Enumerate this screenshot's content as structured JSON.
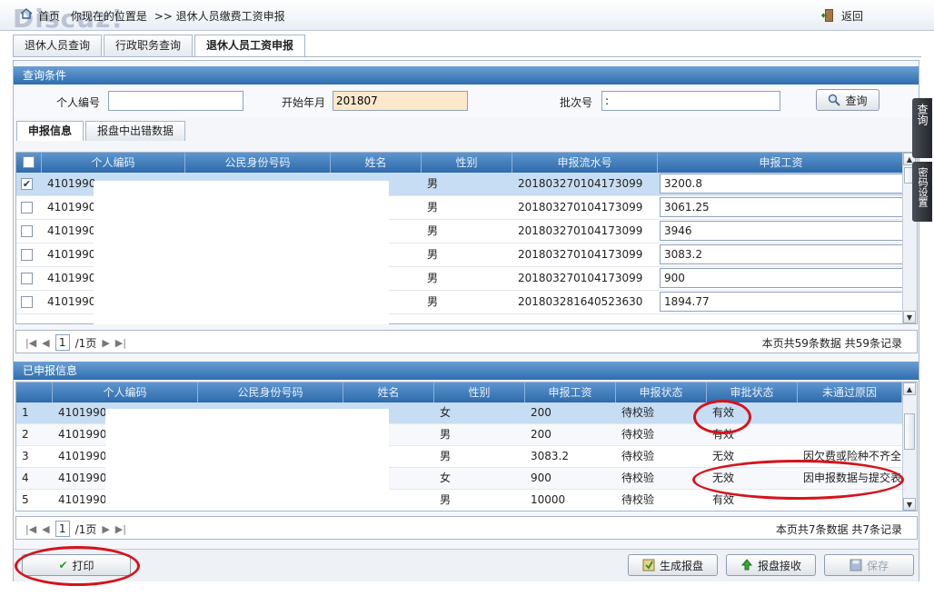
{
  "topbar": {
    "home_label": "首页",
    "location_prefix": "你现在的位置是",
    "location_path": ">> 退休人员缴费工资申报",
    "back_label": "返回",
    "watermark": "Discuz!"
  },
  "main_tabs": [
    {
      "label": "退休人员查询"
    },
    {
      "label": "行政职务查询"
    },
    {
      "label": "退休人员工资申报"
    }
  ],
  "query": {
    "title": "查询条件",
    "person_id_label": "个人编号",
    "person_id_value": "",
    "start_month_label": "开始年月",
    "start_month_value": "201807",
    "batch_label": "批次号",
    "batch_value": ":",
    "search_label": "查询"
  },
  "sub_tabs": [
    {
      "label": "申报信息"
    },
    {
      "label": "报盘中出错数据"
    }
  ],
  "declare_grid": {
    "columns": [
      "个人编码",
      "公民身份号码",
      "姓名",
      "性别",
      "申报流水号",
      "申报工资"
    ],
    "rows": [
      {
        "id": "4101990",
        "gender": "男",
        "serial": "20180327010417309​9",
        "salary": "3200.8",
        "checked": "✔"
      },
      {
        "id": "4101990",
        "gender": "男",
        "serial": "201803270104173099",
        "salary": "3061.25",
        "checked": ""
      },
      {
        "id": "4101990",
        "gender": "男",
        "serial": "201803270104173099",
        "salary": "3946",
        "checked": ""
      },
      {
        "id": "4101990",
        "gender": "男",
        "serial": "201803270104173099",
        "salary": "3083.2",
        "checked": ""
      },
      {
        "id": "4101990",
        "gender": "男",
        "serial": "201803270104173099",
        "salary": "900",
        "checked": ""
      },
      {
        "id": "4101990",
        "gender": "男",
        "serial": "201803281640523630",
        "salary": "1894.77",
        "checked": ""
      }
    ],
    "pager": {
      "page": "1",
      "total_pages": "/1页",
      "summary": "本页共59条数据 共59条记录"
    }
  },
  "submitted": {
    "title": "已申报信息",
    "columns": [
      "个人编码",
      "公民身份号码",
      "姓名",
      "性别",
      "申报工资",
      "申报状态",
      "审批状态",
      "未通过原因"
    ],
    "rows": [
      {
        "no": "1",
        "id": "4101990",
        "gender": "女",
        "salary": "200",
        "status": "待校验",
        "approval": "有效",
        "reason": ""
      },
      {
        "no": "2",
        "id": "4101990",
        "gender": "男",
        "salary": "200",
        "status": "待校验",
        "approval": "有效",
        "reason": ""
      },
      {
        "no": "3",
        "id": "4101990",
        "gender": "男",
        "salary": "3083.2",
        "status": "待校验",
        "approval": "无效",
        "reason": "因欠费或险种不齐全"
      },
      {
        "no": "4",
        "id": "4101990",
        "gender": "女",
        "salary": "900",
        "status": "待校验",
        "approval": "无效",
        "reason": "因申报数据与提交表"
      },
      {
        "no": "5",
        "id": "4101990",
        "gender": "男",
        "salary": "10000",
        "status": "待校验",
        "approval": "有效",
        "reason": ""
      }
    ],
    "pager": {
      "page": "1",
      "total_pages": "/1页",
      "summary": "本页共7条数据 共7条记录"
    }
  },
  "actions": {
    "print_label": "打印",
    "generate_label": "生成报盘",
    "receive_label": "报盘接收",
    "save_label": "保存"
  },
  "side_tabs": {
    "query_label": "查询",
    "password_label": "密码设置"
  },
  "colors": {
    "header_blue": "#2f6db0",
    "annotation_red": "#d4141c",
    "start_month_bg": "#fde8cc"
  }
}
